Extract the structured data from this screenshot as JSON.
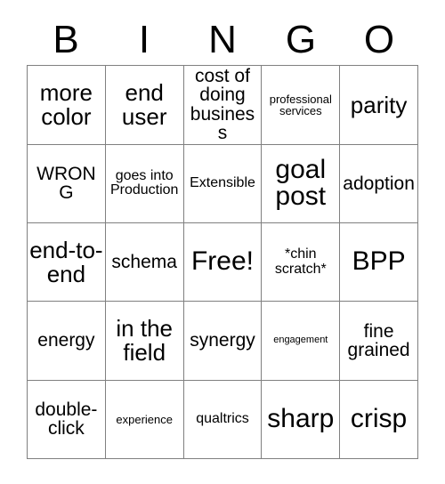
{
  "card": {
    "title": "BINGO",
    "header_letters": [
      "B",
      "I",
      "N",
      "G",
      "O"
    ],
    "free_space_label": "Free!",
    "grid": [
      [
        {
          "label": "more color",
          "size": "lg"
        },
        {
          "label": "end user",
          "size": "lg"
        },
        {
          "label": "cost of doing business",
          "size": "md"
        },
        {
          "label": "professional services",
          "size": "xs"
        },
        {
          "label": "parity",
          "size": "lg"
        }
      ],
      [
        {
          "label": "WRONG",
          "size": "md"
        },
        {
          "label": "goes into Production",
          "size": "sm"
        },
        {
          "label": "Extensible",
          "size": "sm"
        },
        {
          "label": "goal post",
          "size": "xl"
        },
        {
          "label": "adoption",
          "size": "md"
        }
      ],
      [
        {
          "label": "end-to-end",
          "size": "lg"
        },
        {
          "label": "schema",
          "size": "md"
        },
        {
          "label": "Free!",
          "size": "xl"
        },
        {
          "label": "*chin scratch*",
          "size": "sm"
        },
        {
          "label": "BPP",
          "size": "xl"
        }
      ],
      [
        {
          "label": "energy",
          "size": "md"
        },
        {
          "label": "in the field",
          "size": "lg"
        },
        {
          "label": "synergy",
          "size": "md"
        },
        {
          "label": "engagement",
          "size": "xxs"
        },
        {
          "label": "fine grained",
          "size": "md"
        }
      ],
      [
        {
          "label": "double-click",
          "size": "md"
        },
        {
          "label": "experience",
          "size": "xs"
        },
        {
          "label": "qualtrics",
          "size": "sm"
        },
        {
          "label": "sharp",
          "size": "xl"
        },
        {
          "label": "crisp",
          "size": "xl"
        }
      ]
    ],
    "colors": {
      "background": "#ffffff",
      "text": "#000000",
      "border": "#808080"
    }
  }
}
